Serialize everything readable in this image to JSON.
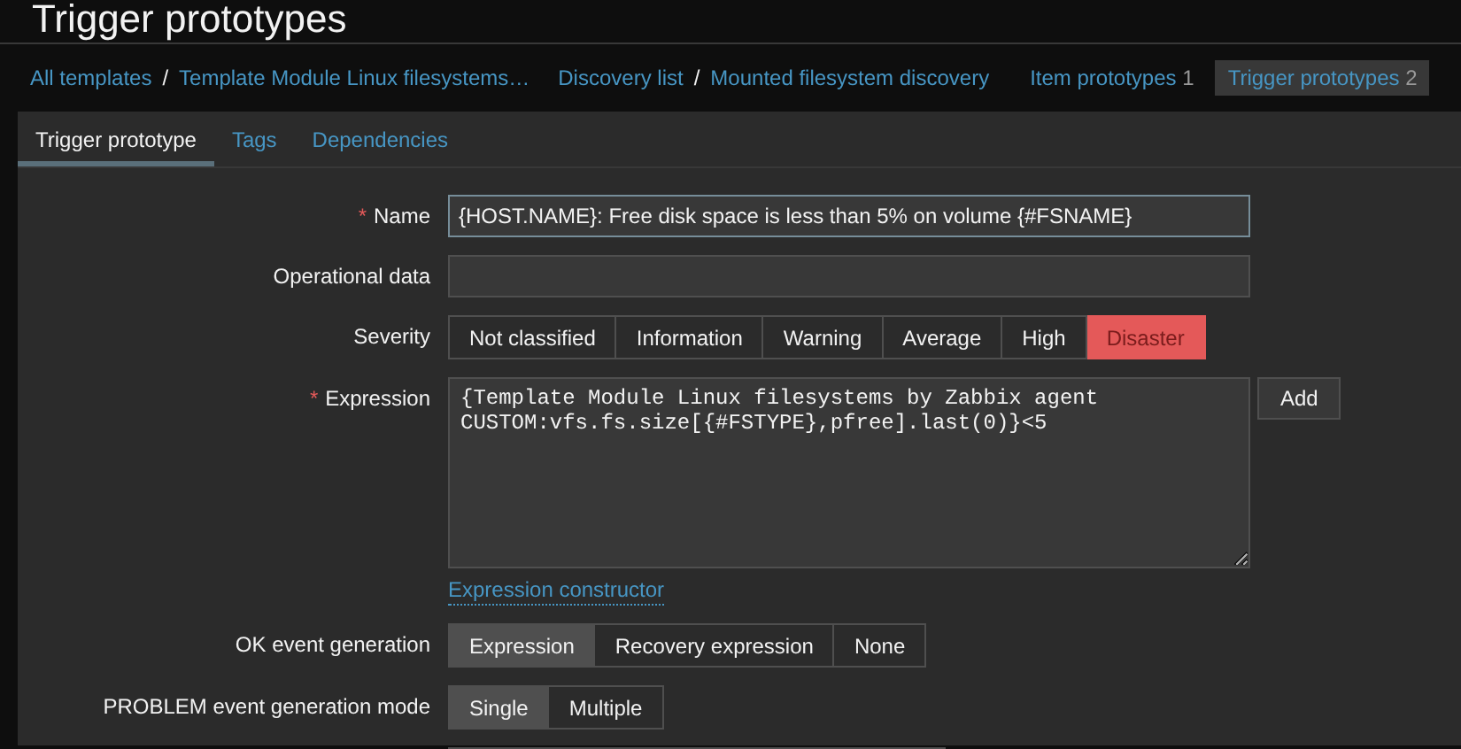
{
  "page_title": "Trigger prototypes",
  "breadcrumbs": [
    {
      "kind": "link",
      "label": "All templates"
    },
    {
      "kind": "separator",
      "label": "/"
    },
    {
      "kind": "link",
      "label": "Template Module Linux filesystems…"
    },
    {
      "kind": "gap"
    },
    {
      "kind": "link",
      "label": "Discovery list"
    },
    {
      "kind": "separator",
      "label": "/"
    },
    {
      "kind": "link",
      "label": "Mounted filesystem discovery"
    },
    {
      "kind": "gap"
    },
    {
      "kind": "counted",
      "label": "Item prototypes",
      "count": "1",
      "selected": false
    },
    {
      "kind": "counted",
      "label": "Trigger prototypes",
      "count": "2",
      "selected": true
    }
  ],
  "tabs": [
    {
      "label": "Trigger prototype",
      "selected": true
    },
    {
      "label": "Tags",
      "selected": false
    },
    {
      "label": "Dependencies",
      "selected": false
    }
  ],
  "form": [
    {
      "kind": "text",
      "label": "Name",
      "required_mark": "*",
      "value": "{HOST.NAME}: Free disk space is less than 5% on volume {#FSNAME}"
    },
    {
      "kind": "text",
      "label": "Operational data"
    },
    {
      "kind": "segments",
      "label": "Severity",
      "options": [
        {
          "label": "Not classified",
          "selected": false
        },
        {
          "label": "Information",
          "selected": false
        },
        {
          "label": "Warning",
          "selected": false
        },
        {
          "label": "Average",
          "selected": false
        },
        {
          "label": "High",
          "selected": false
        },
        {
          "label": "Disaster",
          "selected": true,
          "color": "#e45959"
        }
      ]
    },
    {
      "kind": "textarea",
      "label": "Expression",
      "required_mark": "*",
      "value": "{Template Module Linux filesystems by Zabbix agent\nCUSTOM:vfs.fs.size[{#FSTYPE},pfree].last(0)}<5",
      "button": "Add",
      "link": "Expression constructor"
    },
    {
      "kind": "segments",
      "label": "OK event generation",
      "options": [
        {
          "label": "Expression",
          "selected": true
        },
        {
          "label": "Recovery expression",
          "selected": false
        },
        {
          "label": "None",
          "selected": false
        }
      ]
    },
    {
      "kind": "segments",
      "label": "PROBLEM event generation mode",
      "options": [
        {
          "label": "Single",
          "selected": true
        },
        {
          "label": "Multiple",
          "selected": false
        }
      ]
    }
  ]
}
